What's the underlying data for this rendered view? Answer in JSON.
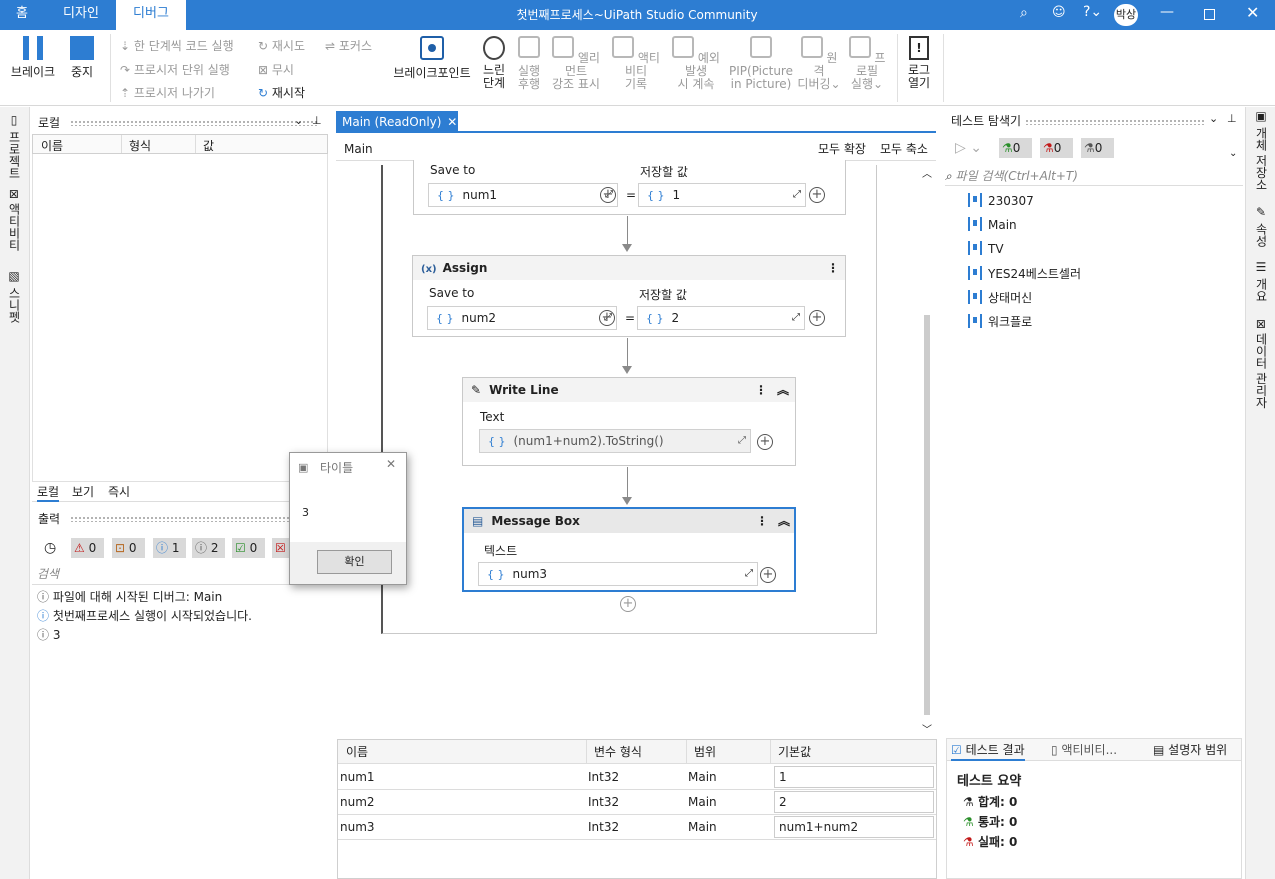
{
  "titlebar": {
    "tabs": [
      "홈",
      "디자인",
      "디버그"
    ],
    "title": "첫번째프로세스~UiPath Studio Community",
    "user": "박상"
  },
  "ribbon": {
    "break": "브레이크",
    "stop": "중지",
    "step_into": "한 단계씩 코드 실행",
    "step_over": "프로시저 단위 실행",
    "step_out": "프로시저 나가기",
    "retry": "재시도",
    "ignore": "무시",
    "restart": "재시작",
    "focus": "포커스",
    "breakpoints": "브레이크포인트",
    "slow_1": "느린",
    "slow_2": "단계",
    "exec_1": "실행",
    "exec_2": "후행",
    "highlight_1": "엘리먼트",
    "highlight_2": "강조 표시",
    "log_1": "액티비티",
    "log_2": "기록",
    "cont_1": "예외 발생",
    "cont_2": "시 계속",
    "pip_1": "PIP(Picture",
    "pip_2": "in Picture)",
    "remote_1": "원격",
    "remote_2": "디버깅",
    "profile_1": "프로필",
    "profile_2": "실행",
    "openlog_1": "로그",
    "openlog_2": "열기"
  },
  "leftbar": {
    "project": "프로젝트",
    "activities": "액티비티",
    "snippets": "스니펫"
  },
  "locals": {
    "title": "로컬",
    "cols": [
      "이름",
      "형식",
      "값"
    ],
    "tabs": [
      "로컬",
      "보기",
      "즉시"
    ]
  },
  "output": {
    "title": "출력",
    "counts": [
      "0",
      "0",
      "1",
      "2",
      "0"
    ],
    "search_placeholder": "검색",
    "lines": [
      "파일에 대해 시작된 디버그: Main",
      "첫번째프로세스 실행이 시작되었습니다.",
      "3"
    ]
  },
  "msgbox": {
    "title": "타이틀",
    "message": "3",
    "ok": "확인"
  },
  "designer": {
    "tab": "Main (ReadOnly)",
    "breadcrumb": "Main",
    "expand_all": "모두 확장",
    "collapse_all": "모두 축소",
    "assign1": {
      "save_to": "Save to",
      "value_label": "저장할 값",
      "var": "num1",
      "value": "1"
    },
    "assign2": {
      "title": "Assign",
      "save_to": "Save to",
      "value_label": "저장할 값",
      "var": "num2",
      "value": "2"
    },
    "writeline": {
      "title": "Write Line",
      "text_label": "Text",
      "text": "(num1+num2).ToString()"
    },
    "messagebox": {
      "title": "Message Box",
      "text_label": "텍스트",
      "text": "num3"
    }
  },
  "variables": {
    "cols": [
      "이름",
      "변수 형식",
      "범위",
      "기본값"
    ],
    "rows": [
      [
        "num1",
        "Int32",
        "Main",
        "1"
      ],
      [
        "num2",
        "Int32",
        "Main",
        "2"
      ],
      [
        "num3",
        "Int32",
        "Main",
        "num1+num2"
      ]
    ]
  },
  "test_explorer": {
    "title": "테스트 탐색기",
    "counts": [
      "0",
      "0",
      "0"
    ],
    "search_placeholder": "파일 검색(Ctrl+Alt+T)",
    "items": [
      "230307",
      "Main",
      "TV",
      "YES24베스트셀러",
      "상태머신",
      "워크플로"
    ]
  },
  "rightbar": {
    "repo": "개체 저장소",
    "props": "속성",
    "outline": "개요",
    "data": "데이터 관리자"
  },
  "test_results": {
    "tabs": [
      "테스트 결과",
      "액티비티...",
      "설명자 범위"
    ],
    "summary": "테스트 요약",
    "total": "합계: 0",
    "passed": "통과: 0",
    "failed": "실패: 0"
  }
}
